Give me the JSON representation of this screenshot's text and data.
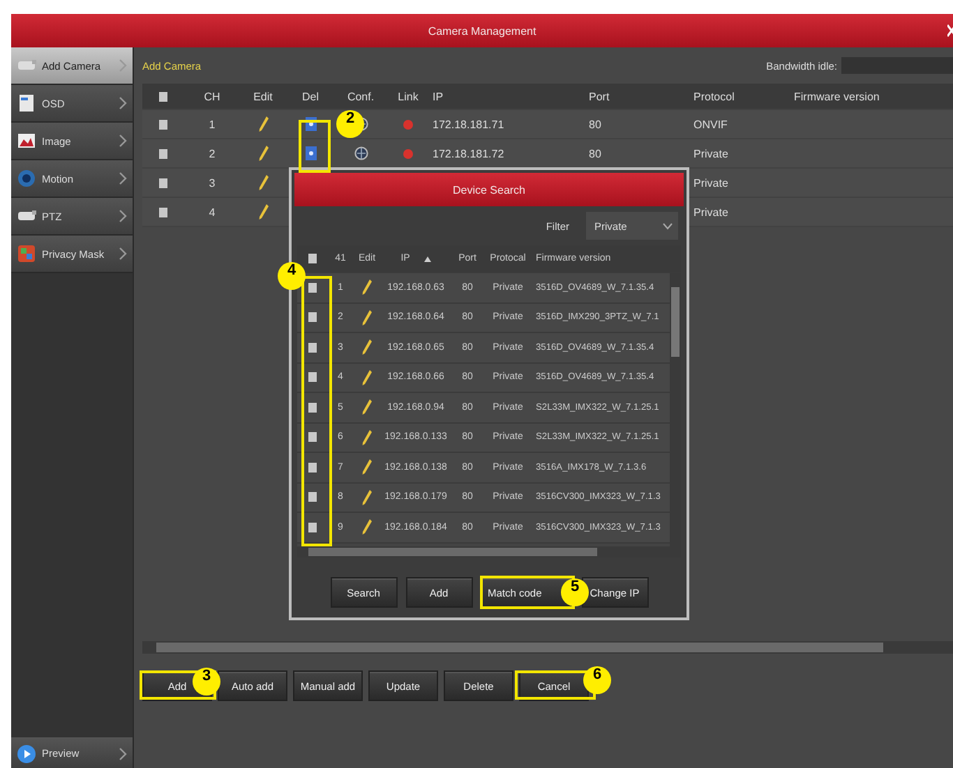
{
  "window": {
    "title": "Camera Management"
  },
  "sidebar": {
    "items": [
      {
        "label": "Add Camera",
        "selected": true
      },
      {
        "label": "OSD",
        "selected": false
      },
      {
        "label": "Image",
        "selected": false
      },
      {
        "label": "Motion",
        "selected": false
      },
      {
        "label": "PTZ",
        "selected": false
      },
      {
        "label": "Privacy Mask",
        "selected": false
      }
    ],
    "footer_item": {
      "label": "Preview"
    }
  },
  "header": {
    "title": "Add Camera",
    "bandwidth_label": "Bandwidth idle:"
  },
  "camera_table": {
    "all_checked": false,
    "columns": [
      "CH",
      "Edit",
      "Del",
      "Conf.",
      "Link",
      "IP",
      "Port",
      "Protocol",
      "Firmware version"
    ],
    "rows": [
      {
        "checked": false,
        "ch": "1",
        "linked": false,
        "ip": "172.18.181.71",
        "port": "80",
        "protocol": "ONVIF"
      },
      {
        "checked": false,
        "ch": "2",
        "linked": false,
        "ip": "172.18.181.72",
        "port": "80",
        "protocol": "Private"
      },
      {
        "checked": false,
        "ch": "3",
        "protocol": "Private"
      },
      {
        "checked": false,
        "ch": "4",
        "protocol": "Private"
      }
    ]
  },
  "buttons": [
    "Add",
    "Auto add",
    "Manual add",
    "Update",
    "Delete",
    "Cancel"
  ],
  "dialog": {
    "title": "Device Search",
    "all_checked": false,
    "filter": {
      "label": "Filter",
      "value": "Private"
    },
    "columns": [
      "41",
      "Edit",
      "IP",
      "Port",
      "Protocal",
      "Firmware version"
    ],
    "rows": [
      {
        "checked": false,
        "no": "1",
        "ip": "192.168.0.63",
        "port": "80",
        "protocol": "Private",
        "firmware": "3516D_OV4689_W_7.1.35.4"
      },
      {
        "checked": false,
        "no": "2",
        "ip": "192.168.0.64",
        "port": "80",
        "protocol": "Private",
        "firmware": "3516D_IMX290_3PTZ_W_7.1"
      },
      {
        "checked": false,
        "no": "3",
        "ip": "192.168.0.65",
        "port": "80",
        "protocol": "Private",
        "firmware": "3516D_OV4689_W_7.1.35.4"
      },
      {
        "checked": false,
        "no": "4",
        "ip": "192.168.0.66",
        "port": "80",
        "protocol": "Private",
        "firmware": "3516D_OV4689_W_7.1.35.4"
      },
      {
        "checked": false,
        "no": "5",
        "ip": "192.168.0.94",
        "port": "80",
        "protocol": "Private",
        "firmware": "S2L33M_IMX322_W_7.1.25.1"
      },
      {
        "checked": false,
        "no": "6",
        "ip": "192.168.0.133",
        "port": "80",
        "protocol": "Private",
        "firmware": "S2L33M_IMX322_W_7.1.25.1"
      },
      {
        "checked": false,
        "no": "7",
        "ip": "192.168.0.138",
        "port": "80",
        "protocol": "Private",
        "firmware": "3516A_IMX178_W_7.1.3.6"
      },
      {
        "checked": false,
        "no": "8",
        "ip": "192.168.0.179",
        "port": "80",
        "protocol": "Private",
        "firmware": "3516CV300_IMX323_W_7.1.3"
      },
      {
        "checked": false,
        "no": "9",
        "ip": "192.168.0.184",
        "port": "80",
        "protocol": "Private",
        "firmware": "3516CV300_IMX323_W_7.1.3"
      }
    ],
    "buttons": [
      "Search",
      "Add",
      "Match code",
      "Change IP"
    ]
  },
  "annotations": [
    {
      "label": "2"
    },
    {
      "label": "4"
    },
    {
      "label": "3"
    },
    {
      "label": "5"
    },
    {
      "label": "6"
    }
  ]
}
